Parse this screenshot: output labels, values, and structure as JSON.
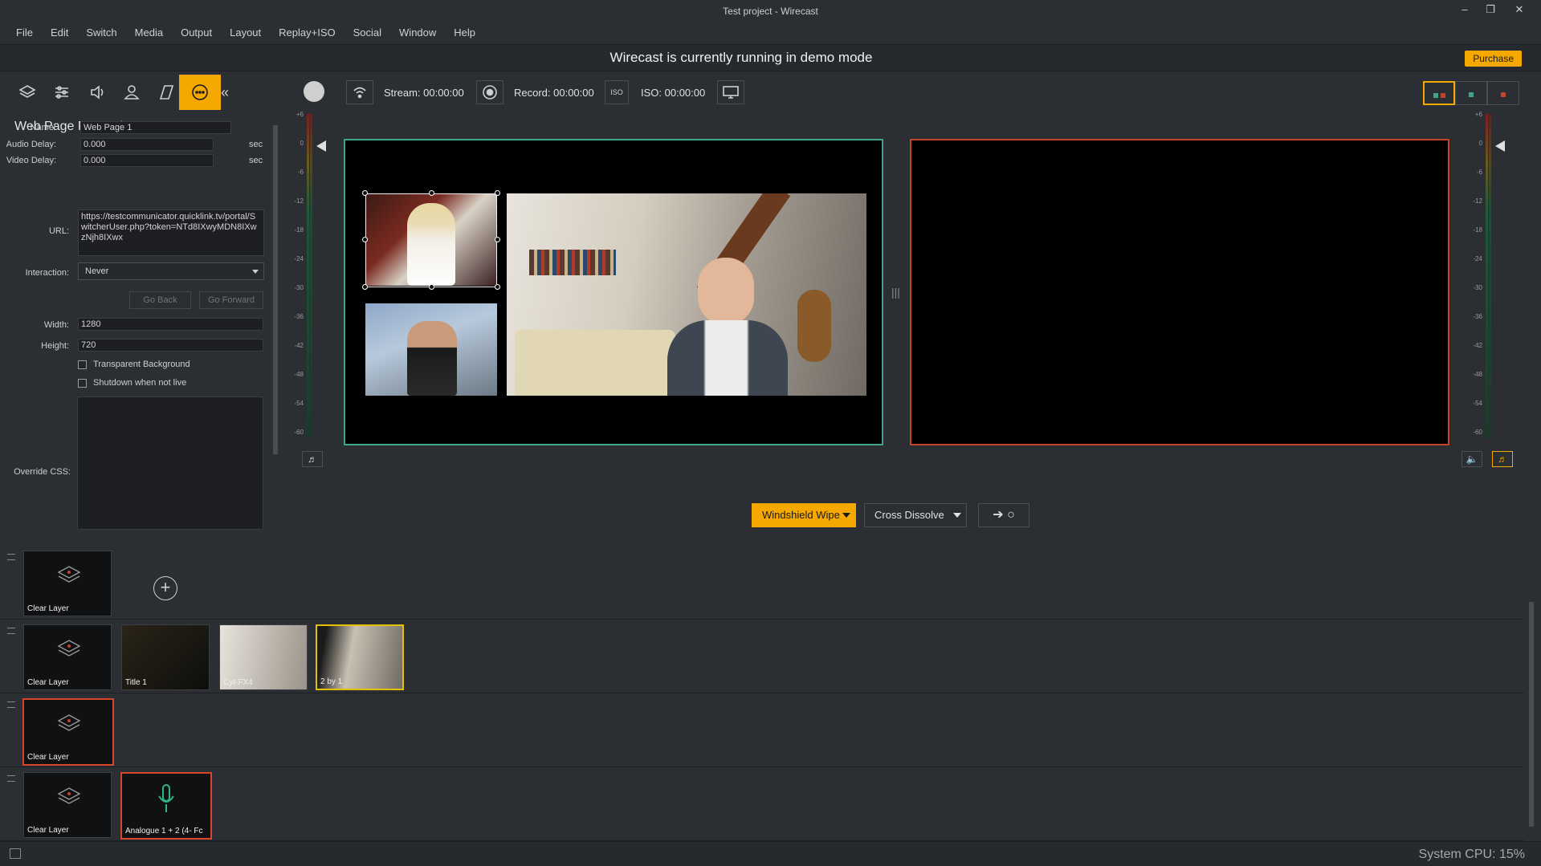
{
  "window": {
    "title": "Test project - Wirecast"
  },
  "menu": [
    "File",
    "Edit",
    "Switch",
    "Media",
    "Output",
    "Layout",
    "Replay+ISO",
    "Social",
    "Window",
    "Help"
  ],
  "demo": {
    "message": "Wirecast is currently running in demo mode",
    "purchase_label": "Purchase"
  },
  "toolbar": {
    "stream_label": "Stream: 00:00:00",
    "record_label": "Record: 00:00:00",
    "iso_label": "ISO: 00:00:00",
    "iso_icon_text": "ISO"
  },
  "properties": {
    "title": "Web Page Properties",
    "name_label": "Name:",
    "name_value": "Web Page 1",
    "audio_delay_label": "Audio Delay:",
    "audio_delay_value": "0.000",
    "video_delay_label": "Video Delay:",
    "video_delay_value": "0.000",
    "sec": "sec",
    "url_label": "URL:",
    "url_value": "https://testcommunicator.quicklink.tv/portal/SwitcherUser.php?token=NTd8IXwyMDN8IXwzNjh8IXwx",
    "interaction_label": "Interaction:",
    "interaction_value": "Never",
    "go_back": "Go Back",
    "go_forward": "Go Forward",
    "width_label": "Width:",
    "width_value": "1280",
    "height_label": "Height:",
    "height_value": "720",
    "transparent_bg": "Transparent Background",
    "shutdown": "Shutdown when not live",
    "override_css_label": "Override CSS:"
  },
  "meter_ticks": [
    "+6",
    "0",
    "-6",
    "-12",
    "-18",
    "-24",
    "-30",
    "-36",
    "-42",
    "-48",
    "-54",
    "-60"
  ],
  "transitions": {
    "first": "Windshield Wipe",
    "second": "Cross Dissolve"
  },
  "layers": [
    {
      "shots": [
        {
          "label": "Clear Layer"
        }
      ]
    },
    {
      "shots": [
        {
          "label": "Clear Layer"
        },
        {
          "label": "Title 1"
        },
        {
          "label": "Cyt-FX4"
        },
        {
          "label": "2 by 1"
        }
      ]
    },
    {
      "shots": [
        {
          "label": "Clear Layer"
        }
      ]
    },
    {
      "shots": [
        {
          "label": "Clear Layer"
        },
        {
          "label": "Analogue 1 + 2 (4- Fc"
        }
      ]
    }
  ],
  "status": {
    "cpu": "System CPU: 15%"
  },
  "colors": {
    "accent": "#f5a800",
    "preview_border": "#3fa58a",
    "live_border": "#c5412e"
  }
}
